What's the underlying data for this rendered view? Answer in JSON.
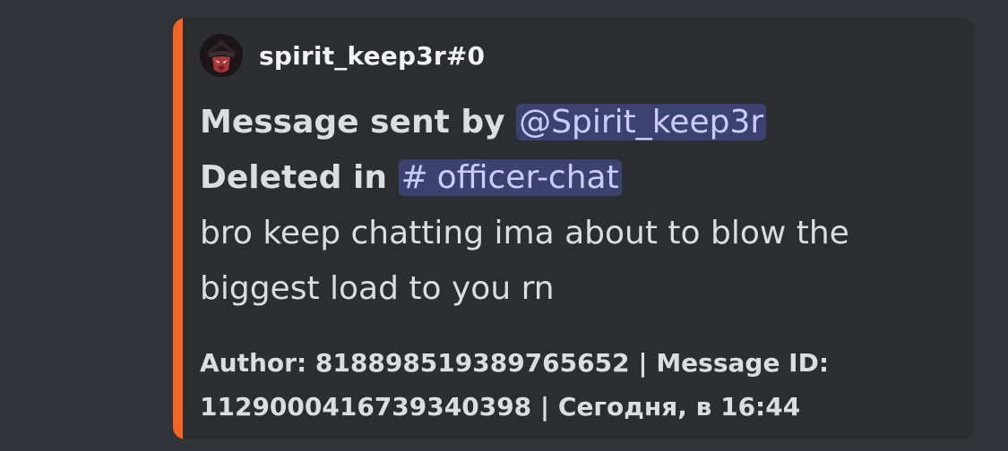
{
  "embed": {
    "accent_color": "#f26522",
    "author": {
      "name": "spirit_keep3r#0",
      "avatar_icon": "hooded-figure-avatar"
    },
    "sent_by_prefix": "Message sent by",
    "sent_by_mention": "@Spirit_keep3r",
    "deleted_prefix": "Deleted in",
    "channel_hash": "#",
    "channel_name": "officer-chat",
    "message_text": "bro keep chatting ima about to blow the biggest load to you rn",
    "footer_text": "Author: 818898519389765652 | Message ID: 1129000416739340398 | Сегодня, в 16:44"
  },
  "colors": {
    "background": "#313338",
    "embed_background": "#2b2d31",
    "mention_background": "#3c4270",
    "mention_text": "#c9cdfb"
  }
}
